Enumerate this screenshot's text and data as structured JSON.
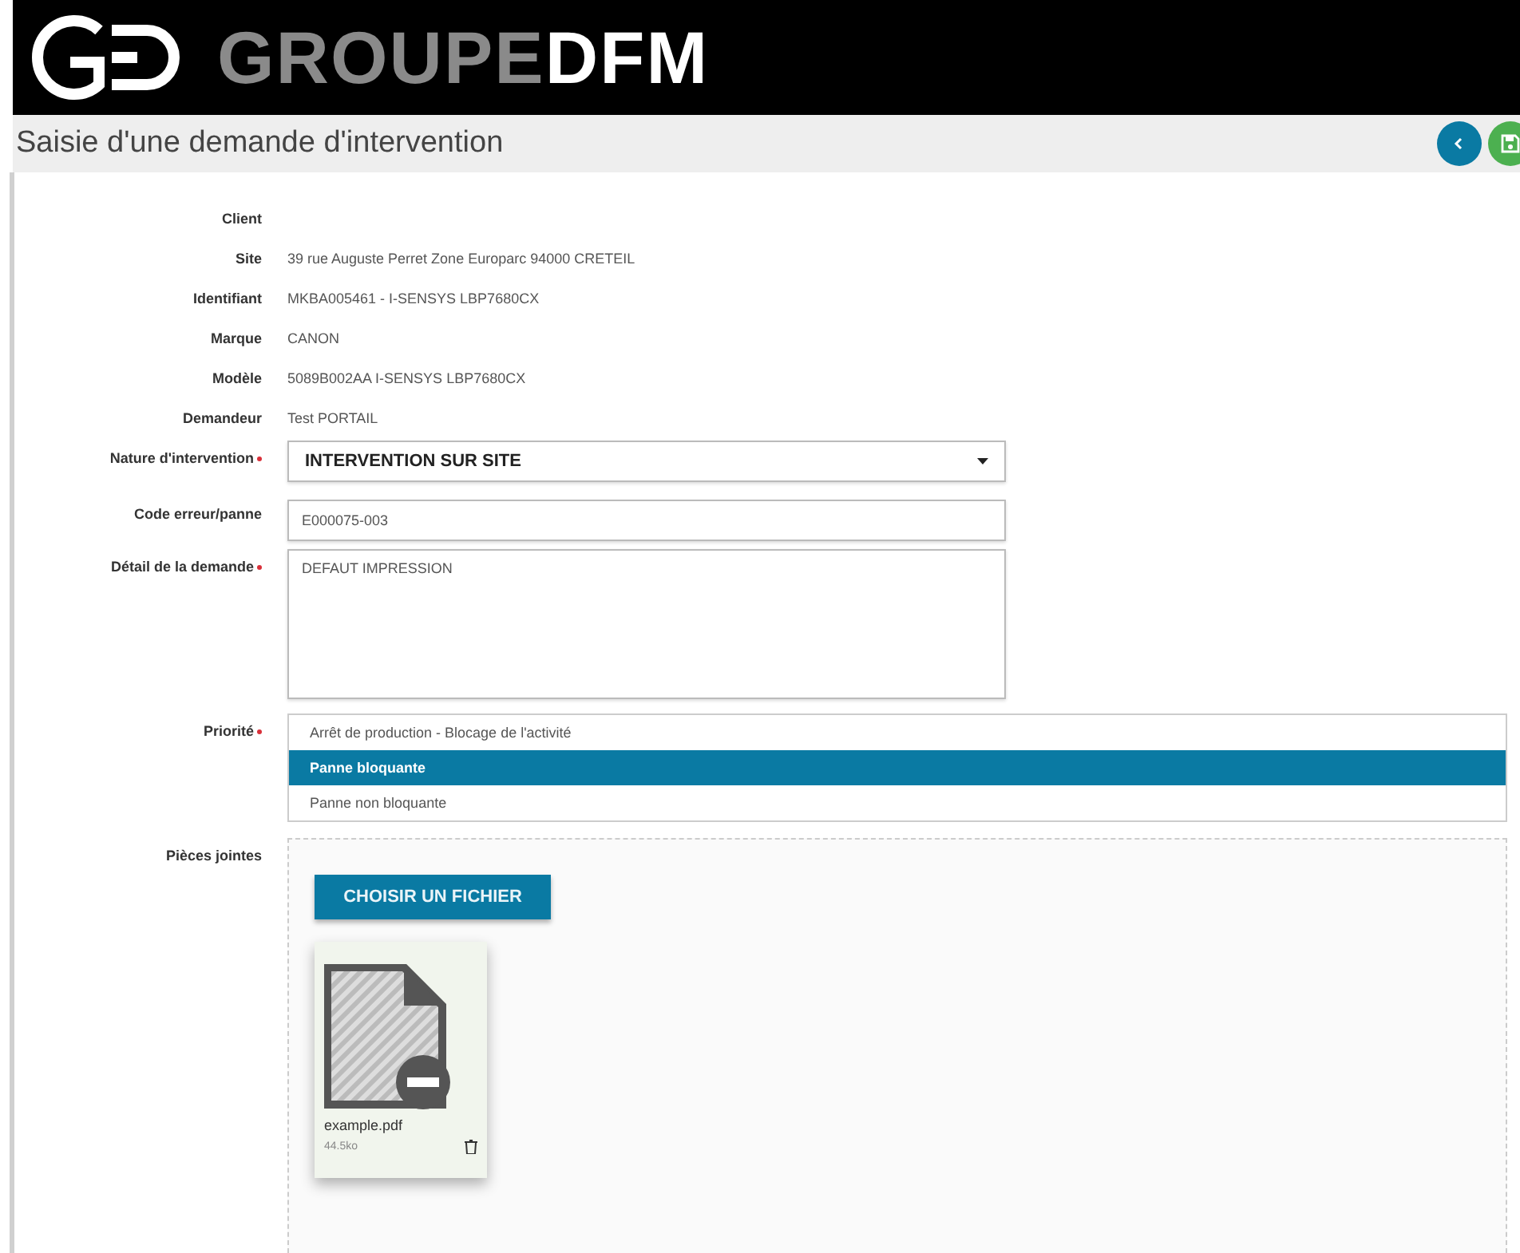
{
  "header": {
    "brand_light": "GROUPE",
    "brand_bold": "DFM"
  },
  "title_bar": {
    "title": "Saisie d'une demande d'intervention"
  },
  "info_rows": [
    {
      "label": "Client",
      "value": ""
    },
    {
      "label": "Site",
      "value": "39 rue Auguste Perret Zone Europarc 94000 CRETEIL"
    },
    {
      "label": "Identifiant",
      "value": "MKBA005461 - I-SENSYS LBP7680CX"
    },
    {
      "label": "Marque",
      "value": "CANON"
    },
    {
      "label": "Modèle",
      "value": "5089B002AA I-SENSYS LBP7680CX"
    },
    {
      "label": "Demandeur",
      "value": "Test PORTAIL"
    }
  ],
  "nature": {
    "label": "Nature d'intervention",
    "required": true,
    "value": "INTERVENTION SUR SITE"
  },
  "code": {
    "label": "Code erreur/panne",
    "required": false,
    "value": "E000075-003"
  },
  "detail": {
    "label": "Détail de la demande",
    "required": true,
    "value": "DEFAUT IMPRESSION"
  },
  "priority": {
    "label": "Priorité",
    "required": true,
    "options": [
      {
        "label": "Arrêt de production - Blocage de l'activité",
        "selected": false
      },
      {
        "label": "Panne bloquante",
        "selected": true
      },
      {
        "label": "Panne non bloquante",
        "selected": false
      }
    ]
  },
  "attachments": {
    "label": "Pièces jointes",
    "button": "CHOISIR UN FICHIER",
    "files": [
      {
        "name": "example.pdf",
        "size": "44.5ko"
      }
    ]
  }
}
